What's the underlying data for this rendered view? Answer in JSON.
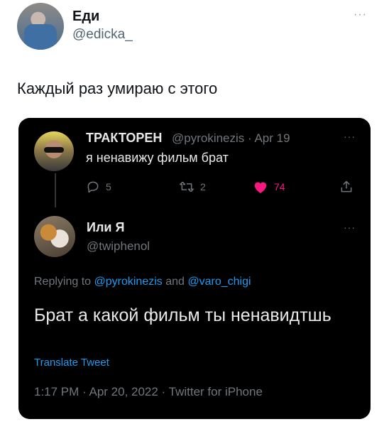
{
  "outer_tweet": {
    "author_name": "Еди",
    "author_handle": "@edicka_",
    "more_label": "···",
    "text": "Каждый раз умираю с этого"
  },
  "card": {
    "tweet1": {
      "name": "ТРАКТОРЕН",
      "meta": "@pyrokinezis · Apr 19",
      "more_label": "···",
      "text": "я ненавижу фильм брат",
      "replies": "5",
      "retweets": "2",
      "likes": "74"
    },
    "tweet2": {
      "name": "Или Я",
      "handle": "@twiphenol",
      "more_label": "···",
      "replying_prefix": "Replying to",
      "reply_to_1": "@pyrokinezis",
      "reply_conj": "and",
      "reply_to_2": "@varo_chigi",
      "text": "Брат а какой фильм ты ненавидтшь",
      "translate": "Translate Tweet",
      "timestamp": "1:17 PM · Apr 20, 2022 · Twitter for iPhone"
    }
  },
  "colors": {
    "card_bg": "#000000",
    "link": "#1d9bf0",
    "like": "#f91880",
    "muted": "#71767b"
  },
  "icons": [
    "reply-icon",
    "retweet-icon",
    "heart-icon",
    "share-icon",
    "more-icon"
  ]
}
